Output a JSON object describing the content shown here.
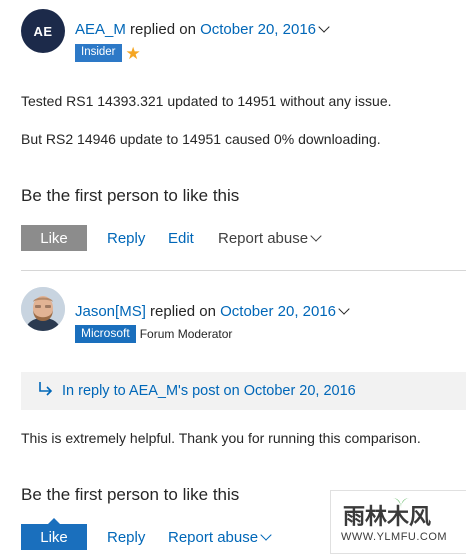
{
  "post1": {
    "avatar_initials": "AE",
    "author": "AEA_M",
    "replied_on": "replied on",
    "date": "October 20, 2016",
    "badge": "Insider",
    "body_line1": "Tested RS1 14393.321 updated to 14951 without any issue.",
    "body_line2": "But RS2 14946 update to 14951 caused 0% downloading.",
    "likes_text": "Be the first person to like this",
    "actions": {
      "like": "Like",
      "reply": "Reply",
      "edit": "Edit",
      "report": "Report abuse"
    }
  },
  "post2": {
    "author": "Jason[MS]",
    "replied_on": "replied on",
    "date": "October 20, 2016",
    "badge": "Microsoft",
    "role": "Forum Moderator",
    "in_reply_to": "In reply to AEA_M's post on October 20, 2016",
    "body": "This is extremely helpful.  Thank you for running this comparison.",
    "likes_text": "Be the first person to like this",
    "actions": {
      "like": "Like",
      "reply": "Reply",
      "report": "Report abuse"
    }
  },
  "watermark": {
    "text": "雨林木风",
    "url": "WWW.YLMFU.COM"
  },
  "colors": {
    "link": "#0067b8",
    "badge_blue": "#1a6fbd",
    "like_gray": "#8c8c8c",
    "star": "#f5a623"
  }
}
